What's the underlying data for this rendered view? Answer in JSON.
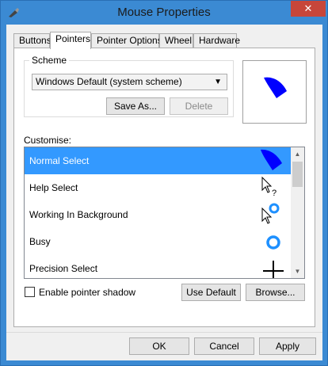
{
  "window": {
    "title": "Mouse Properties",
    "close_glyph": "✕"
  },
  "tabs": [
    {
      "label": "Buttons"
    },
    {
      "label": "Pointers"
    },
    {
      "label": "Pointer Options"
    },
    {
      "label": "Wheel"
    },
    {
      "label": "Hardware"
    }
  ],
  "scheme": {
    "group_label": "Scheme",
    "selected": "Windows Default (system scheme)",
    "dropdown_arrow": "▼",
    "save_as_label": "Save As...",
    "delete_label": "Delete"
  },
  "customise": {
    "label": "Customise:",
    "items": [
      {
        "label": "Normal Select",
        "icon": "normal-select-icon"
      },
      {
        "label": "Help Select",
        "icon": "help-select-icon"
      },
      {
        "label": "Working In Background",
        "icon": "working-background-icon"
      },
      {
        "label": "Busy",
        "icon": "busy-icon"
      },
      {
        "label": "Precision Select",
        "icon": "precision-select-icon"
      }
    ],
    "selected_index": 0,
    "scroll_up_glyph": "▲",
    "scroll_down_glyph": "▼"
  },
  "options": {
    "pointer_shadow_label": "Enable pointer shadow",
    "pointer_shadow_checked": false,
    "use_default_label": "Use Default",
    "browse_label": "Browse..."
  },
  "dialog": {
    "ok_label": "OK",
    "cancel_label": "Cancel",
    "apply_label": "Apply"
  },
  "colors": {
    "accent": "#3399ff",
    "titlebar": "#3b8ad3",
    "close": "#c7463a",
    "cursor_blue": "#0000ff"
  }
}
